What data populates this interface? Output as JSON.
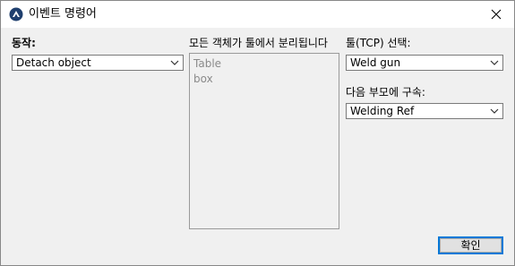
{
  "window": {
    "title": "이벤트 명령어",
    "icon": "app-logo-icon",
    "close_icon": "close-icon"
  },
  "action": {
    "label": "동작:",
    "selected": "Detach object"
  },
  "objects": {
    "label": "모든 객체가 툴에서 분리됩니다",
    "items": [
      "Table",
      "box"
    ]
  },
  "tool": {
    "label": "툴(TCP) 선택:",
    "selected": "Weld gun"
  },
  "parent": {
    "label": "다음 부모에 구속:",
    "selected": "Welding Ref"
  },
  "buttons": {
    "ok_label": "확인"
  },
  "colors": {
    "accent": "#0078d7",
    "window_bg": "#f0f0f0",
    "disabled_text": "#8a8a8a"
  }
}
